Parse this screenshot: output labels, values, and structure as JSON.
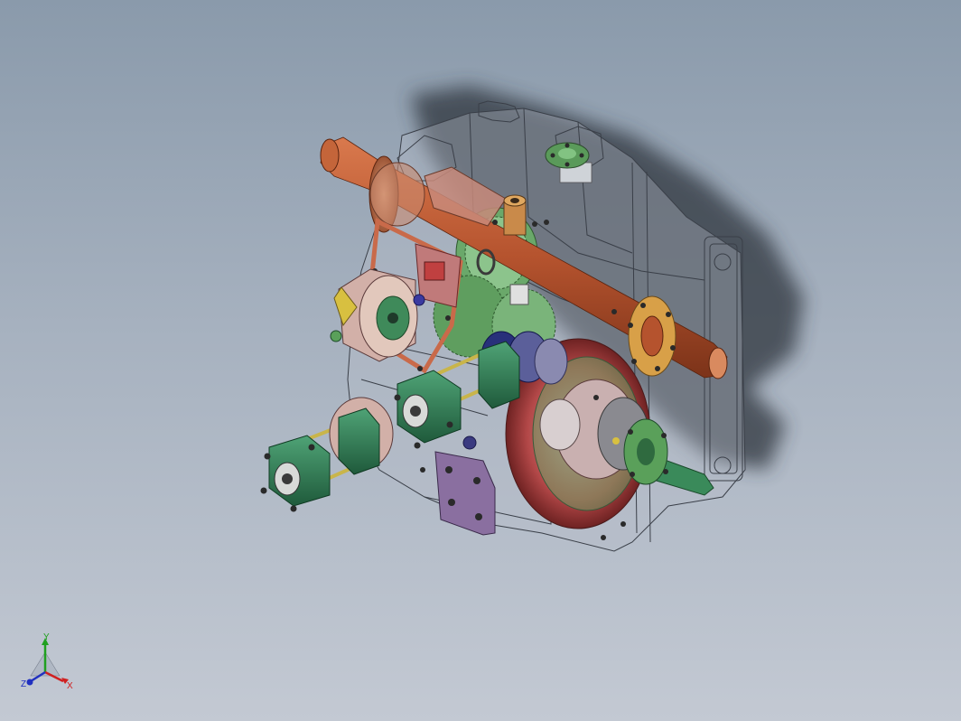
{
  "viewport": {
    "background_top": "#8a9aab",
    "background_bottom": "#c3c9d3"
  },
  "model": {
    "colors": {
      "housing_wire": "#3a3f48",
      "housing_fill": "#b8bec8",
      "shaft": "#b5532e",
      "shaft_light": "#d9794d",
      "flange": "#c97a5a",
      "gear_green": "#6aa86a",
      "cylinder_green": "#2f7a52",
      "rod_yellow": "#c9b54a",
      "plate_purple": "#8a6fa0",
      "pulley_red": "#b34848",
      "coupling_blue": "#28307a",
      "shadow": "#2e343c"
    }
  },
  "triad": {
    "x_label": "X",
    "y_label": "Y",
    "z_label": "Z",
    "x_color": "#d02020",
    "y_color": "#20a020",
    "z_color": "#2030c0"
  }
}
